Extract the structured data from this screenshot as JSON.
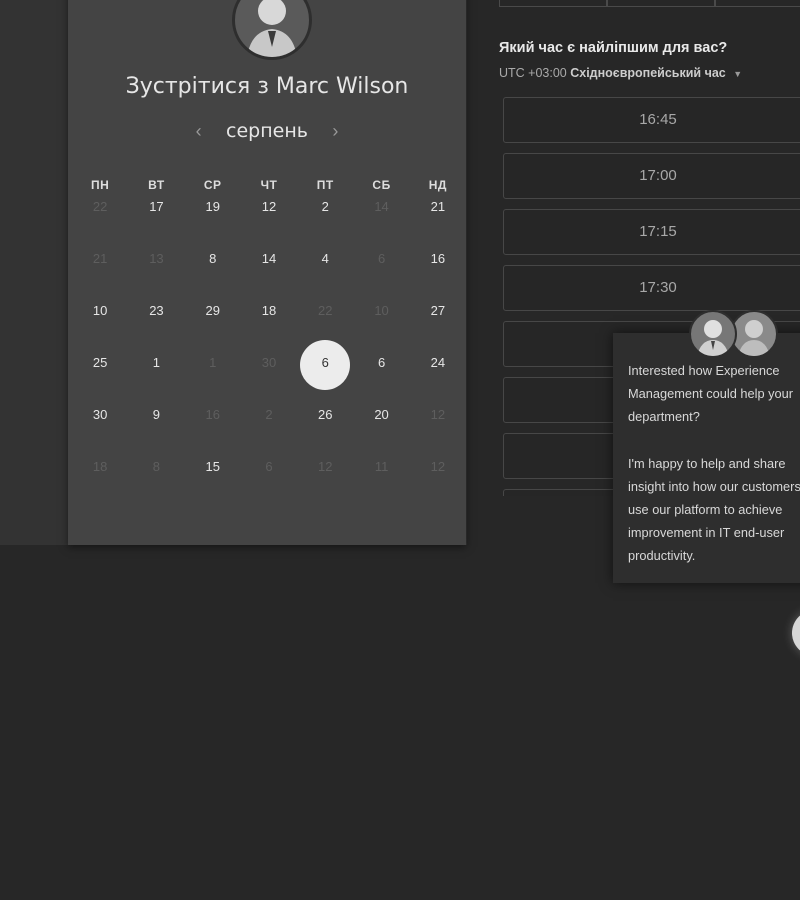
{
  "meeting": {
    "title": "Зустрітися з Marc Wilson",
    "month": "серпень",
    "prev_icon": "chevron-left-icon",
    "next_icon": "chevron-right-icon"
  },
  "calendar": {
    "weekdays": [
      "ПН",
      "ВТ",
      "СР",
      "ЧТ",
      "ПТ",
      "СБ",
      "НД"
    ],
    "weeks": [
      [
        {
          "d": "22",
          "m": true
        },
        {
          "d": "17"
        },
        {
          "d": "19"
        },
        {
          "d": "12"
        },
        {
          "d": "2"
        },
        {
          "d": "14",
          "m": true
        },
        {
          "d": "21"
        }
      ],
      [
        {
          "d": "21",
          "m": true
        },
        {
          "d": "13",
          "m": true
        },
        {
          "d": "8"
        },
        {
          "d": "14"
        },
        {
          "d": "4"
        },
        {
          "d": "6",
          "m": true
        },
        {
          "d": "16"
        }
      ],
      [
        {
          "d": "10"
        },
        {
          "d": "23"
        },
        {
          "d": "29"
        },
        {
          "d": "18"
        },
        {
          "d": "22",
          "m": true
        },
        {
          "d": "10",
          "m": true
        },
        {
          "d": "27"
        }
      ],
      [
        {
          "d": "25"
        },
        {
          "d": "1"
        },
        {
          "d": "1",
          "m": true
        },
        {
          "d": "30",
          "m": true
        },
        {
          "d": "6",
          "s": true
        },
        {
          "d": "6"
        },
        {
          "d": "24"
        }
      ],
      [
        {
          "d": "30"
        },
        {
          "d": "9"
        },
        {
          "d": "16",
          "m": true
        },
        {
          "d": "2",
          "m": true
        },
        {
          "d": "26"
        },
        {
          "d": "20"
        },
        {
          "d": "12",
          "m": true
        }
      ],
      [
        {
          "d": "18",
          "m": true
        },
        {
          "d": "8",
          "m": true
        },
        {
          "d": "15"
        },
        {
          "d": "6",
          "m": true
        },
        {
          "d": "12",
          "m": true
        },
        {
          "d": "11",
          "m": true
        },
        {
          "d": "12",
          "m": true
        }
      ]
    ]
  },
  "time_picker": {
    "question": "Який час є найліпшим для вас?",
    "timezone_offset": "UTC +03:00",
    "timezone_name": "Східноєвропейський час",
    "slots": [
      "16:45",
      "17:00",
      "17:15",
      "17:30",
      "",
      "",
      "",
      ""
    ]
  },
  "chat": {
    "message_1": "Interested how Experience\nManagement could help your\ndepartment?",
    "message_2": "I'm happy to help and share\ninsight into how our customers\nuse our platform to achieve\nimprovement in IT end-user\nproductivity."
  },
  "colors": {
    "background": "#272727",
    "panel": "#444444",
    "selected_day": "#ececec"
  }
}
